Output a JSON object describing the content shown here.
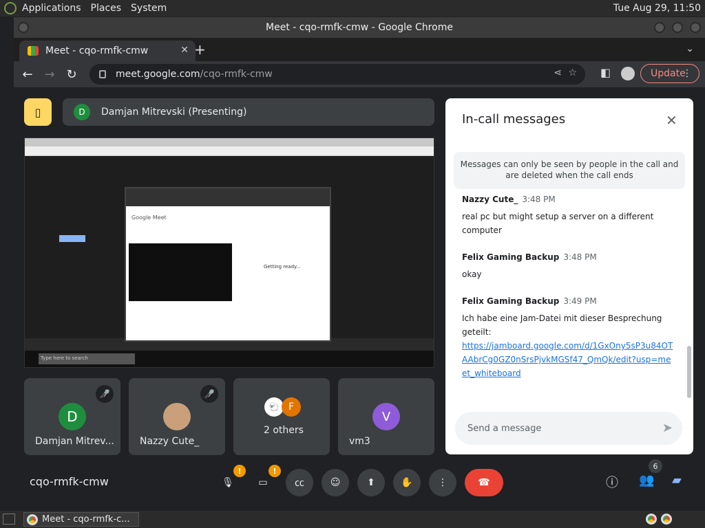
{
  "system": {
    "menus": [
      "Applications",
      "Places",
      "System"
    ],
    "clock": "Tue Aug 29, 11:50"
  },
  "window": {
    "title": "Meet - cqo-rmfk-cmw - Google Chrome"
  },
  "browser": {
    "tab_title": "Meet - cqo-rmfk-cmw",
    "url_host": "meet.google.com",
    "url_path": "/cqo-rmfk-cmw",
    "update_label": "Update"
  },
  "meet": {
    "presenter": "Damjan Mitrevski (Presenting)",
    "presenter_initial": "D",
    "meeting_code": "cqo-rmfk-cmw",
    "share": {
      "gm_title": "Google Meet",
      "getting_ready": "Getting ready...",
      "taskbar_search": "Type here to search"
    },
    "tiles": [
      {
        "initial": "D",
        "name": "Damjan Mitrev...",
        "color": "#1e8e3e"
      },
      {
        "initial": "",
        "name": "Nazzy Cute_",
        "color": "#c58af9"
      },
      {
        "initial": "F",
        "name": "2 others",
        "color": "#e37400"
      },
      {
        "initial": "V",
        "name": "vm3",
        "color": "#8e5cd9"
      }
    ],
    "participants_count": "6",
    "warn_mark": "!"
  },
  "chat": {
    "title": "In-call messages",
    "notice": "Messages can only be seen by people in the call and are deleted when the call ends",
    "messages": [
      {
        "sender": "Nazzy Cute_",
        "time": "3:48 PM",
        "text": "real pc but might setup a server on a different computer"
      },
      {
        "sender": "Felix Gaming Backup",
        "time": "3:48 PM",
        "text": "okay"
      },
      {
        "sender": "Felix Gaming Backup",
        "time": "3:49 PM",
        "text": "Ich habe eine Jam-Datei mit dieser Besprechung geteilt:",
        "link": "https://jamboard.google.com/d/1GxOny5sP3u84OTAAbrCg0GZ0nSrsPjvkMGSf47_QmQk/edit?usp=meet_whiteboard"
      }
    ],
    "compose_placeholder": "Send a message"
  },
  "taskbar": {
    "task_label": "Meet - cqo-rmfk-c..."
  }
}
